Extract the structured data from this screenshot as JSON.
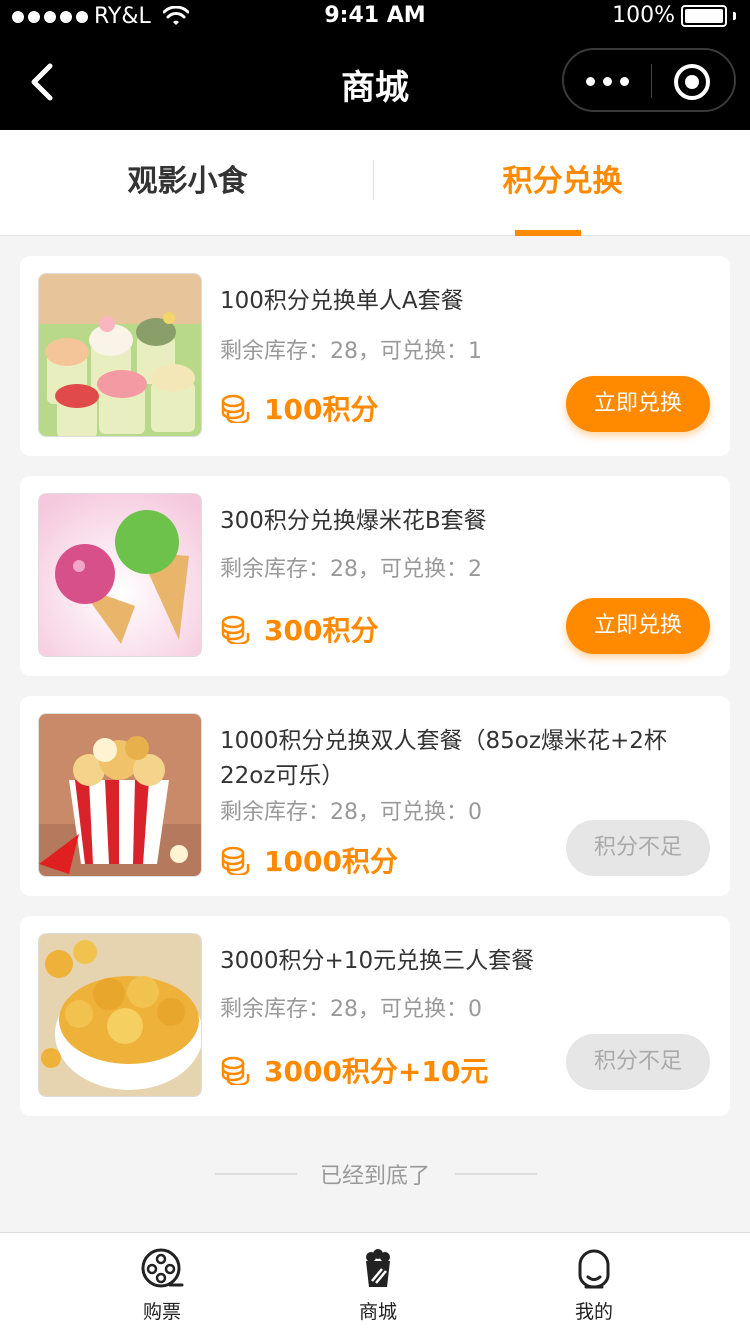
{
  "status_bar": {
    "carrier": "RY&L",
    "time": "9:41 AM",
    "battery": "100%"
  },
  "nav": {
    "title": "商城"
  },
  "tabs": [
    {
      "label": "观影小食",
      "active": false
    },
    {
      "label": "积分兑换",
      "active": true
    }
  ],
  "items": [
    {
      "title": "100积分兑换单人A套餐",
      "stock": "剩余库存：28，可兑换：1",
      "price": "100积分",
      "button": "立即兑换",
      "image": "frozen-yogurt-cups"
    },
    {
      "title": "300积分兑换爆米花B套餐",
      "stock": "剩余库存：28，可兑换：2",
      "price": "300积分",
      "button": "立即兑换",
      "image": "ice-cream-cones"
    },
    {
      "title": "1000积分兑换双人套餐（85oz爆米花+2杯22oz可乐）",
      "stock": "剩余库存：28，可兑换：0",
      "price": "1000积分",
      "button": "积分不足",
      "image": "popcorn-bucket"
    },
    {
      "title": "3000积分+10元兑换三人套餐",
      "stock": "剩余库存：28，可兑换：0",
      "price": "3000积分+10元",
      "button": "积分不足",
      "image": "caramel-popcorn-bowl"
    }
  ],
  "end_message": "已经到底了",
  "tabbar": [
    {
      "label": "购票",
      "icon": "film-reel-icon"
    },
    {
      "label": "商城",
      "icon": "popcorn-icon"
    },
    {
      "label": "我的",
      "icon": "user-icon"
    }
  ],
  "colors": {
    "accent": "#ff8a00",
    "disabled": "#e6e6e6",
    "nav_bg": "#000000"
  }
}
